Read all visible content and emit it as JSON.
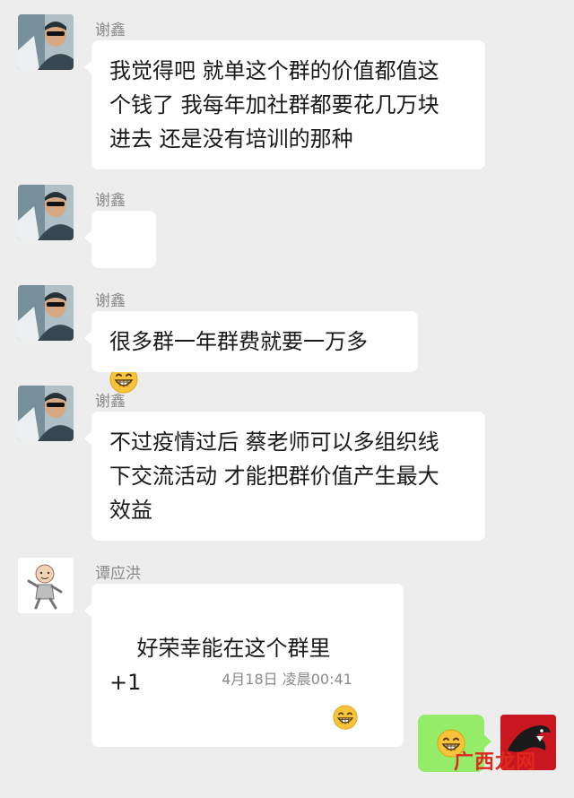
{
  "messages": [
    {
      "sender": "谢鑫",
      "text": "我觉得吧 就单这个群的价值都值这\n个钱了 我每年加社群都要花几万块\n进去 还是没有培训的那种"
    },
    {
      "sender": "谢鑫",
      "emoji": "grinning-face-icon"
    },
    {
      "sender": "谢鑫",
      "text": "很多群一年群费就要一万多"
    },
    {
      "sender": "谢鑫",
      "text": "不过疫情过后 蔡老师可以多组织线\n下交流活动 才能把群价值产生最大\n效益"
    },
    {
      "sender": "谭应洪",
      "text_before": "好荣幸能在这个群里",
      "text_after": "+1"
    }
  ],
  "timestamp": "4月18日 凌晨00:41",
  "self_message": {
    "emoji": "grinning-face-icon"
  },
  "watermark": "广西龙网",
  "colors": {
    "background": "#ededed",
    "bubble": "#ffffff",
    "sent_bubble": "#95ec69",
    "meta_text": "#8a8a8a",
    "watermark": "#e0281e"
  }
}
